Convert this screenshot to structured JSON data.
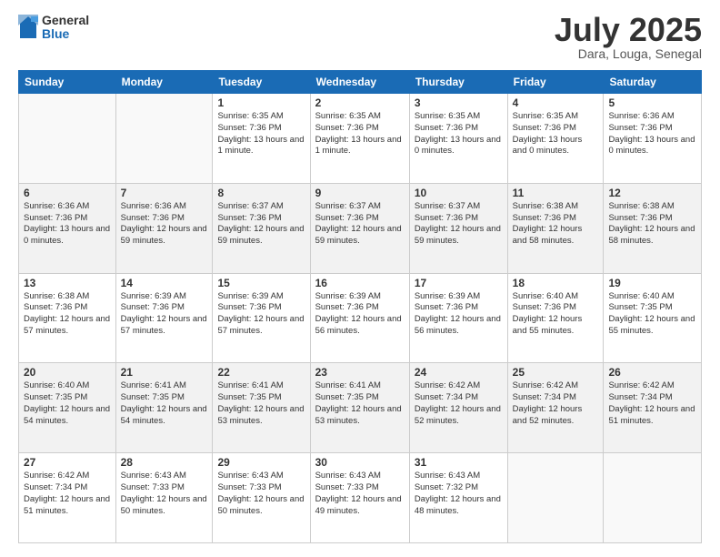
{
  "header": {
    "logo_general": "General",
    "logo_blue": "Blue",
    "month_title": "July 2025",
    "location": "Dara, Louga, Senegal"
  },
  "days_of_week": [
    "Sunday",
    "Monday",
    "Tuesday",
    "Wednesday",
    "Thursday",
    "Friday",
    "Saturday"
  ],
  "weeks": [
    [
      {
        "day": "",
        "info": ""
      },
      {
        "day": "",
        "info": ""
      },
      {
        "day": "1",
        "info": "Sunrise: 6:35 AM\nSunset: 7:36 PM\nDaylight: 13 hours\nand 1 minute."
      },
      {
        "day": "2",
        "info": "Sunrise: 6:35 AM\nSunset: 7:36 PM\nDaylight: 13 hours\nand 1 minute."
      },
      {
        "day": "3",
        "info": "Sunrise: 6:35 AM\nSunset: 7:36 PM\nDaylight: 13 hours\nand 0 minutes."
      },
      {
        "day": "4",
        "info": "Sunrise: 6:35 AM\nSunset: 7:36 PM\nDaylight: 13 hours\nand 0 minutes."
      },
      {
        "day": "5",
        "info": "Sunrise: 6:36 AM\nSunset: 7:36 PM\nDaylight: 13 hours\nand 0 minutes."
      }
    ],
    [
      {
        "day": "6",
        "info": "Sunrise: 6:36 AM\nSunset: 7:36 PM\nDaylight: 13 hours\nand 0 minutes."
      },
      {
        "day": "7",
        "info": "Sunrise: 6:36 AM\nSunset: 7:36 PM\nDaylight: 12 hours\nand 59 minutes."
      },
      {
        "day": "8",
        "info": "Sunrise: 6:37 AM\nSunset: 7:36 PM\nDaylight: 12 hours\nand 59 minutes."
      },
      {
        "day": "9",
        "info": "Sunrise: 6:37 AM\nSunset: 7:36 PM\nDaylight: 12 hours\nand 59 minutes."
      },
      {
        "day": "10",
        "info": "Sunrise: 6:37 AM\nSunset: 7:36 PM\nDaylight: 12 hours\nand 59 minutes."
      },
      {
        "day": "11",
        "info": "Sunrise: 6:38 AM\nSunset: 7:36 PM\nDaylight: 12 hours\nand 58 minutes."
      },
      {
        "day": "12",
        "info": "Sunrise: 6:38 AM\nSunset: 7:36 PM\nDaylight: 12 hours\nand 58 minutes."
      }
    ],
    [
      {
        "day": "13",
        "info": "Sunrise: 6:38 AM\nSunset: 7:36 PM\nDaylight: 12 hours\nand 57 minutes."
      },
      {
        "day": "14",
        "info": "Sunrise: 6:39 AM\nSunset: 7:36 PM\nDaylight: 12 hours\nand 57 minutes."
      },
      {
        "day": "15",
        "info": "Sunrise: 6:39 AM\nSunset: 7:36 PM\nDaylight: 12 hours\nand 57 minutes."
      },
      {
        "day": "16",
        "info": "Sunrise: 6:39 AM\nSunset: 7:36 PM\nDaylight: 12 hours\nand 56 minutes."
      },
      {
        "day": "17",
        "info": "Sunrise: 6:39 AM\nSunset: 7:36 PM\nDaylight: 12 hours\nand 56 minutes."
      },
      {
        "day": "18",
        "info": "Sunrise: 6:40 AM\nSunset: 7:36 PM\nDaylight: 12 hours\nand 55 minutes."
      },
      {
        "day": "19",
        "info": "Sunrise: 6:40 AM\nSunset: 7:35 PM\nDaylight: 12 hours\nand 55 minutes."
      }
    ],
    [
      {
        "day": "20",
        "info": "Sunrise: 6:40 AM\nSunset: 7:35 PM\nDaylight: 12 hours\nand 54 minutes."
      },
      {
        "day": "21",
        "info": "Sunrise: 6:41 AM\nSunset: 7:35 PM\nDaylight: 12 hours\nand 54 minutes."
      },
      {
        "day": "22",
        "info": "Sunrise: 6:41 AM\nSunset: 7:35 PM\nDaylight: 12 hours\nand 53 minutes."
      },
      {
        "day": "23",
        "info": "Sunrise: 6:41 AM\nSunset: 7:35 PM\nDaylight: 12 hours\nand 53 minutes."
      },
      {
        "day": "24",
        "info": "Sunrise: 6:42 AM\nSunset: 7:34 PM\nDaylight: 12 hours\nand 52 minutes."
      },
      {
        "day": "25",
        "info": "Sunrise: 6:42 AM\nSunset: 7:34 PM\nDaylight: 12 hours\nand 52 minutes."
      },
      {
        "day": "26",
        "info": "Sunrise: 6:42 AM\nSunset: 7:34 PM\nDaylight: 12 hours\nand 51 minutes."
      }
    ],
    [
      {
        "day": "27",
        "info": "Sunrise: 6:42 AM\nSunset: 7:34 PM\nDaylight: 12 hours\nand 51 minutes."
      },
      {
        "day": "28",
        "info": "Sunrise: 6:43 AM\nSunset: 7:33 PM\nDaylight: 12 hours\nand 50 minutes."
      },
      {
        "day": "29",
        "info": "Sunrise: 6:43 AM\nSunset: 7:33 PM\nDaylight: 12 hours\nand 50 minutes."
      },
      {
        "day": "30",
        "info": "Sunrise: 6:43 AM\nSunset: 7:33 PM\nDaylight: 12 hours\nand 49 minutes."
      },
      {
        "day": "31",
        "info": "Sunrise: 6:43 AM\nSunset: 7:32 PM\nDaylight: 12 hours\nand 48 minutes."
      },
      {
        "day": "",
        "info": ""
      },
      {
        "day": "",
        "info": ""
      }
    ]
  ]
}
